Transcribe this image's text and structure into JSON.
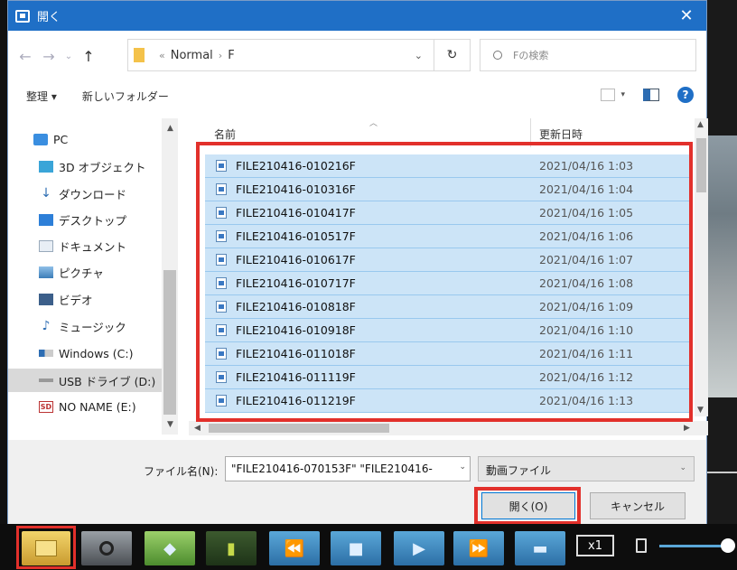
{
  "dialog": {
    "title": "開く",
    "close_label": "✕"
  },
  "address": {
    "prefix_sep": "«",
    "crumbs": [
      "Normal",
      "F"
    ],
    "sep": "›",
    "dropdown": "⌄",
    "refresh": "↻",
    "search_placeholder": "Fの検索"
  },
  "toolbar": {
    "organize_label": "整理 ▾",
    "new_folder_label": "新しいフォルダー"
  },
  "nav": {
    "items": [
      {
        "label": "PC",
        "icon": "pc-icon"
      },
      {
        "label": "3D オブジェクト",
        "icon": "3d-objects-icon"
      },
      {
        "label": "ダウンロード",
        "icon": "download-icon"
      },
      {
        "label": "デスクトップ",
        "icon": "desktop-icon"
      },
      {
        "label": "ドキュメント",
        "icon": "document-icon"
      },
      {
        "label": "ピクチャ",
        "icon": "picture-icon"
      },
      {
        "label": "ビデオ",
        "icon": "video-icon"
      },
      {
        "label": "ミュージック",
        "icon": "music-icon"
      },
      {
        "label": "Windows (C:)",
        "icon": "drive-icon"
      },
      {
        "label": "USB ドライブ (D:)",
        "icon": "usb-drive-icon"
      },
      {
        "label": "NO NAME (E:)",
        "icon": "sd-card-icon"
      }
    ],
    "selected_index": 9
  },
  "list": {
    "col_name": "名前",
    "col_date": "更新日時",
    "rows": [
      {
        "name": "FILE210416-010216F",
        "date": "2021/04/16 1:03"
      },
      {
        "name": "FILE210416-010316F",
        "date": "2021/04/16 1:04"
      },
      {
        "name": "FILE210416-010417F",
        "date": "2021/04/16 1:05"
      },
      {
        "name": "FILE210416-010517F",
        "date": "2021/04/16 1:06"
      },
      {
        "name": "FILE210416-010617F",
        "date": "2021/04/16 1:07"
      },
      {
        "name": "FILE210416-010717F",
        "date": "2021/04/16 1:08"
      },
      {
        "name": "FILE210416-010818F",
        "date": "2021/04/16 1:09"
      },
      {
        "name": "FILE210416-010918F",
        "date": "2021/04/16 1:10"
      },
      {
        "name": "FILE210416-011018F",
        "date": "2021/04/16 1:11"
      },
      {
        "name": "FILE210416-011119F",
        "date": "2021/04/16 1:12"
      },
      {
        "name": "FILE210416-011219F",
        "date": "2021/04/16 1:13"
      }
    ]
  },
  "bottom": {
    "filename_label": "ファイル名(N):",
    "filename_value": "\"FILE210416-070153F\" \"FILE210416-",
    "filetype_value": "動画ファイル",
    "open_label": "開く(O)",
    "cancel_label": "キャンセル"
  },
  "player": {
    "speed_label": "x1"
  },
  "colors": {
    "titlebar": "#1f6fc6",
    "selection": "#cce4f7",
    "highlight_box": "#e2302b"
  }
}
